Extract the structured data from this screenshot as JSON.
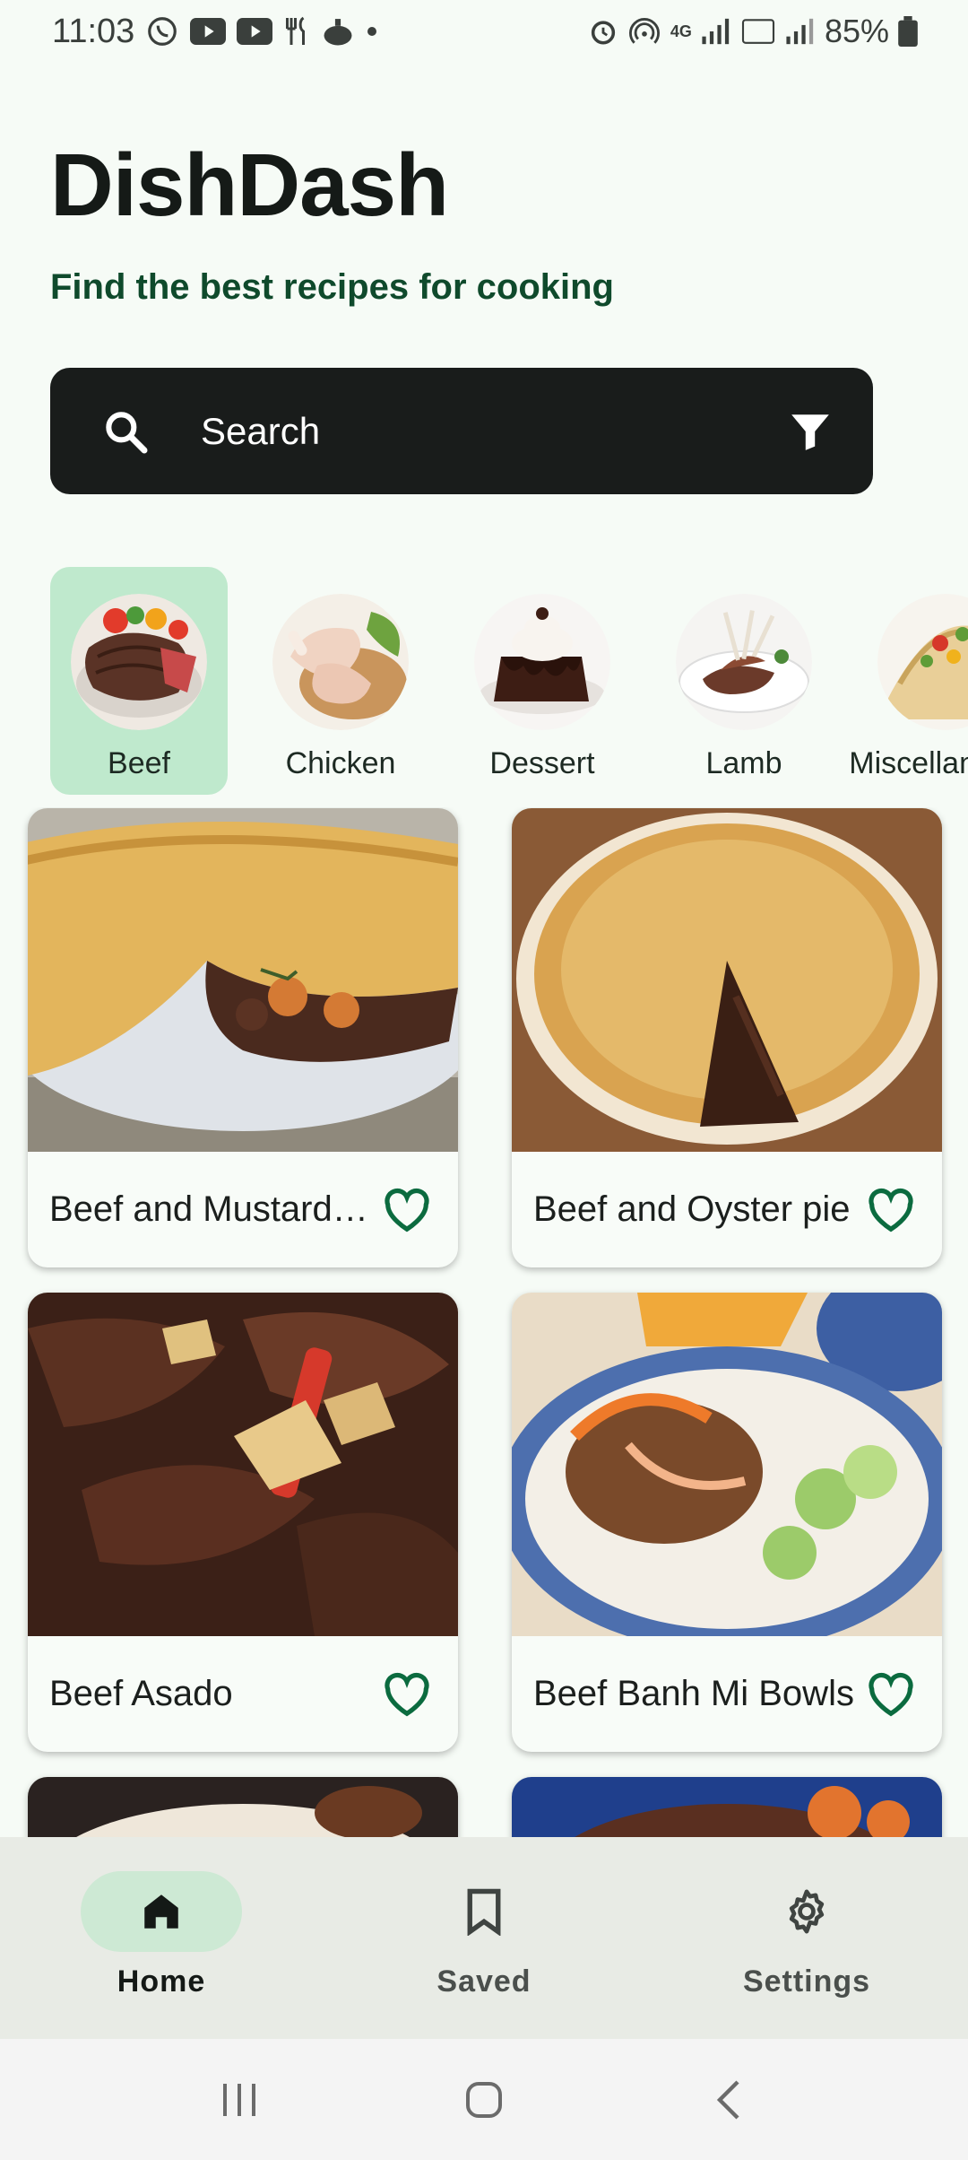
{
  "status_bar": {
    "time": "11:03",
    "battery": "85%",
    "network": "4G"
  },
  "header": {
    "title": "DishDash",
    "subtitle": "Find the best recipes for cooking"
  },
  "search": {
    "placeholder": "Search",
    "value": ""
  },
  "categories": [
    {
      "label": "Beef",
      "selected": true
    },
    {
      "label": "Chicken",
      "selected": false
    },
    {
      "label": "Dessert",
      "selected": false
    },
    {
      "label": "Lamb",
      "selected": false
    },
    {
      "label": "Miscellaneous",
      "selected": false
    }
  ],
  "recipes": [
    {
      "title": "Beef and Mustard Pie",
      "favorite": false
    },
    {
      "title": "Beef and Oyster pie",
      "favorite": false
    },
    {
      "title": "Beef Asado",
      "favorite": false
    },
    {
      "title": "Beef Banh Mi Bowls",
      "favorite": false
    }
  ],
  "bottom_nav": {
    "items": [
      {
        "label": "Home",
        "active": true
      },
      {
        "label": "Saved",
        "active": false
      },
      {
        "label": "Settings",
        "active": false
      }
    ]
  },
  "colors": {
    "accent": "#0b6b3f",
    "selected_category_bg": "#bfe9cd",
    "search_bg": "#191c1b",
    "nav_bg": "#e8ebe5"
  }
}
